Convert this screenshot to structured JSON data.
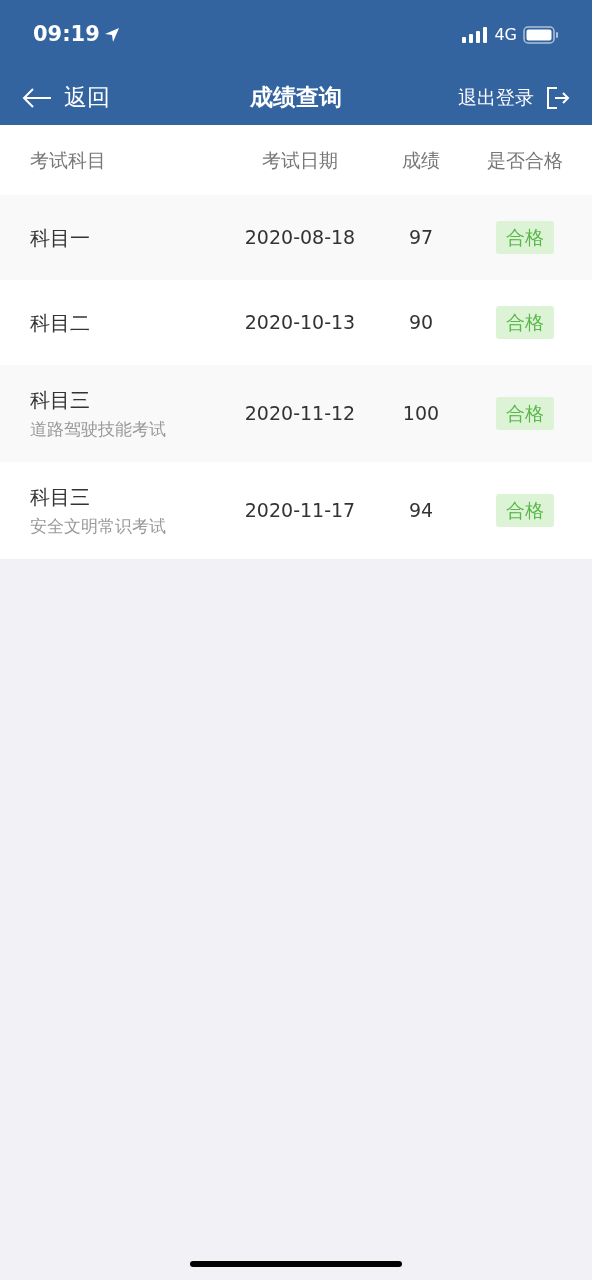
{
  "status_bar": {
    "time": "09:19",
    "network": "4G"
  },
  "nav": {
    "back": "返回",
    "title": "成绩查询",
    "logout": "退出登录"
  },
  "table": {
    "columns": [
      "考试科目",
      "考试日期",
      "成绩",
      "是否合格"
    ],
    "rows": [
      {
        "subject": "科目一",
        "date": "2020-08-18",
        "score": "97",
        "result": "合格",
        "passed": true
      },
      {
        "subject": "科目二",
        "date": "2020-10-13",
        "score": "90",
        "result": "合格",
        "passed": true
      },
      {
        "subject": "科目三",
        "note": "道路驾驶技能考试",
        "date": "2020-11-12",
        "score": "100",
        "result": "合格",
        "passed": true
      },
      {
        "subject": "科目三",
        "note": "安全文明常识考试",
        "date": "2020-11-17",
        "score": "94",
        "result": "合格",
        "passed": true
      }
    ]
  }
}
